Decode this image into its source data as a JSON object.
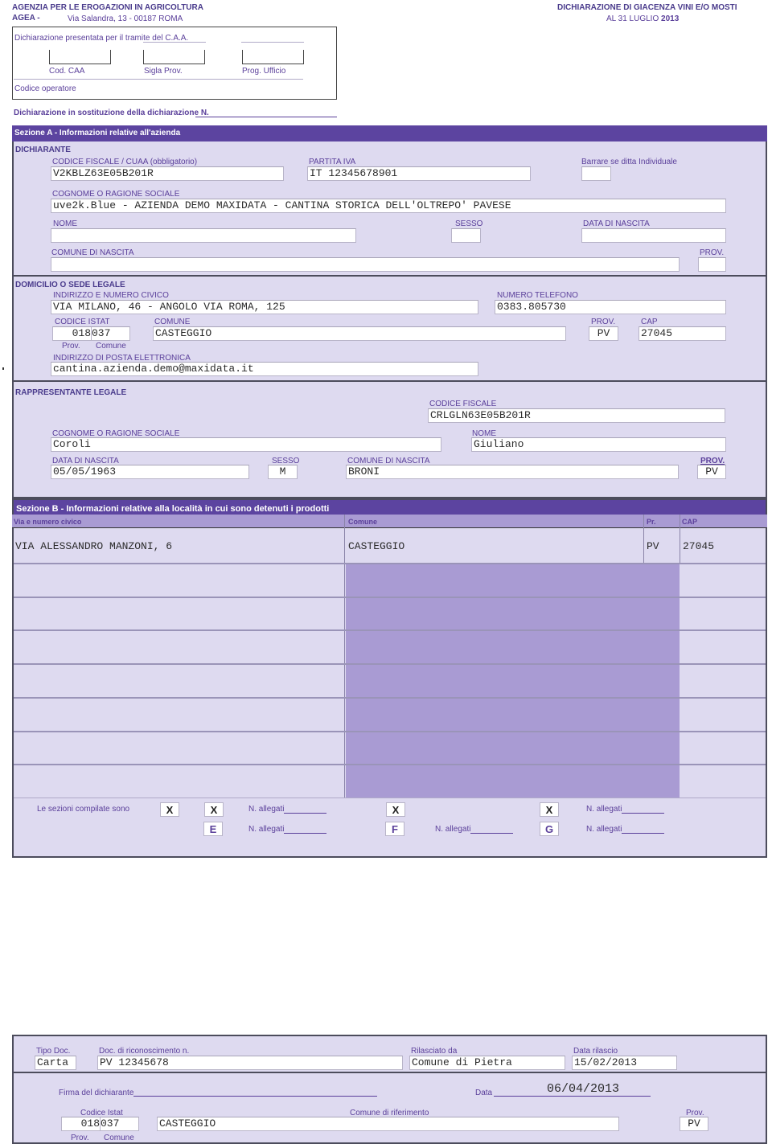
{
  "header": {
    "agency": "AGENZIA PER LE EROGAZIONI IN AGRICOLTURA",
    "agea_label": "AGEA -",
    "address": "Via Salandra, 13 - 00187 ROMA",
    "doc_title": "DICHIARAZIONE DI GIACENZA VINI E/O MOSTI",
    "doc_date_prefix": "AL 31 LUGLIO",
    "doc_year": "2013"
  },
  "caa_box": {
    "presented_label": "Dichiarazione presentata per il tramite del C.A.A.",
    "cod_caa_label": "Cod. CAA",
    "sigla_prov_label": "Sigla Prov.",
    "prog_ufficio_label": "Prog. Ufficio",
    "codice_operatore_label": "Codice operatore",
    "cod_caa_value": "",
    "sigla_prov_value": "",
    "prog_ufficio_value": ""
  },
  "sostituzione": {
    "label": "Dichiarazione in sostituzione della dichiarazione N.",
    "value": ""
  },
  "sezione_a": {
    "title": "Sezione A - Informazioni relative all'azienda",
    "dichiarante": {
      "heading": "DICHIARANTE",
      "codice_fiscale_label": "CODICE FISCALE / CUAA (obbligatorio)",
      "codice_fiscale": "V2KBLZ63E05B201R",
      "partita_iva_label": "PARTITA IVA",
      "partita_iva": "IT 12345678901",
      "ditta_individuale_label": "Barrare se ditta Individuale",
      "ditta_individuale": "",
      "cognome_label": "COGNOME O RAGIONE SOCIALE",
      "cognome": "uve2k.Blue - AZIENDA DEMO MAXIDATA - CANTINA STORICA DELL'OLTREPO' PAVESE",
      "nome_label": "NOME",
      "nome": "",
      "sesso_label": "SESSO",
      "sesso": "",
      "data_nascita_label": "DATA DI NASCITA",
      "data_nascita": "",
      "comune_nascita_label": "COMUNE DI NASCITA",
      "comune_nascita": "",
      "prov_label": "PROV.",
      "prov": ""
    },
    "domicilio": {
      "heading": "DOMICILIO O SEDE LEGALE",
      "indirizzo_label": "INDIRIZZO E NUMERO CIVICO",
      "indirizzo": "VIA MILANO, 46 - ANGOLO VIA ROMA, 125",
      "telefono_label": "NUMERO TELEFONO",
      "telefono": "0383.805730",
      "codice_istat_label": "CODICE ISTAT",
      "istat_prov": "018",
      "istat_comune": "037",
      "istat_prov_label": "Prov.",
      "istat_comune_label": "Comune",
      "comune_label": "COMUNE",
      "comune": "CASTEGGIO",
      "prov_label": "PROV.",
      "prov": "PV",
      "cap_label": "CAP",
      "cap": "27045",
      "email_label": "INDIRIZZO DI POSTA ELETTRONICA",
      "email": "cantina.azienda.demo@maxidata.it"
    },
    "rappresentante": {
      "heading": "RAPPRESENTANTE LEGALE",
      "codice_fiscale_label": "CODICE FISCALE",
      "codice_fiscale": "CRLGLN63E05B201R",
      "cognome_label": "COGNOME O RAGIONE SOCIALE",
      "cognome": "Coroli",
      "nome_label": "NOME",
      "nome": "Giuliano",
      "data_nascita_label": "DATA DI NASCITA",
      "data_nascita": "05/05/1963",
      "sesso_label": "SESSO",
      "sesso": "M",
      "comune_nascita_label": "COMUNE DI NASCITA",
      "comune_nascita": "BRONI",
      "prov_label": "PROV.",
      "prov": "PV"
    }
  },
  "sezione_b": {
    "title": "Sezione B - Informazioni relative alla località in cui sono detenuti i prodotti",
    "columns": [
      "Via e numero civico",
      "Comune",
      "Pr.",
      "CAP"
    ],
    "rows": [
      [
        "VIA ALESSANDRO MANZONI, 6",
        "CASTEGGIO",
        "PV",
        "27045"
      ],
      [
        "",
        "",
        "",
        ""
      ],
      [
        "",
        "",
        "",
        ""
      ],
      [
        "",
        "",
        "",
        ""
      ],
      [
        "",
        "",
        "",
        ""
      ],
      [
        "",
        "",
        "",
        ""
      ],
      [
        "",
        "",
        "",
        ""
      ],
      [
        "",
        "",
        "",
        ""
      ]
    ],
    "sezioni_compilate_label": "Le sezioni compilate sono",
    "checkboxes": [
      {
        "id": "a",
        "mark": "X"
      },
      {
        "id": "b",
        "mark": "X"
      },
      {
        "id": "c",
        "mark": "X"
      },
      {
        "id": "d",
        "mark": "X"
      },
      {
        "id": "e",
        "mark": "E"
      },
      {
        "id": "f",
        "mark": "F"
      },
      {
        "id": "g",
        "mark": "G"
      }
    ],
    "allegati_label": "N. allegati"
  },
  "footer": {
    "tipo_doc_label": "Tipo Doc.",
    "tipo_doc": "Carta",
    "doc_num_label": "Doc. di riconoscimento n.",
    "doc_num": "PV 12345678",
    "rilasciato_label": "Rilasciato da",
    "rilasciato": "Comune di Pietra",
    "data_rilascio_label": "Data rilascio",
    "data_rilascio": "15/02/2013",
    "firma_label": "Firma del dichiarante",
    "data_label": "Data",
    "data": "06/04/2013",
    "codice_istat_label": "Codice Istat",
    "istat_prov": "018",
    "istat_comune": "037",
    "istat_prov_label": "Prov.",
    "istat_comune_label": "Comune",
    "comune_rif_label": "Comune di riferimento",
    "comune_rif": "CASTEGGIO",
    "prov_label": "Prov.",
    "prov": "PV"
  },
  "colors": {
    "section_bar": "#5c44a0",
    "panel_bg": "#dedaf0",
    "header_row": "#a99bd3",
    "label_text": "#5a3f9a"
  }
}
